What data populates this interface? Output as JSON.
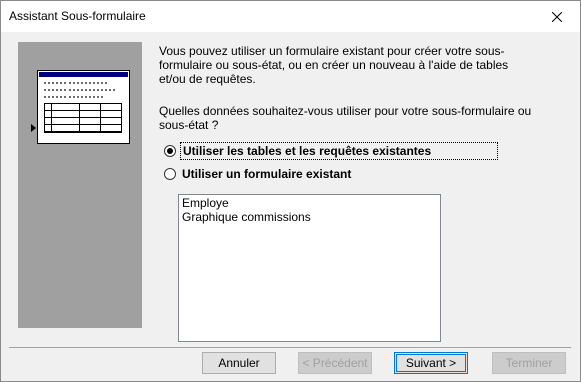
{
  "window": {
    "title": "Assistant Sous-formulaire"
  },
  "description": "Vous pouvez utiliser un formulaire existant pour créer votre sous-formulaire ou sous-état, ou en créer un nouveau à l'aide de tables et/ou de requêtes.",
  "question": "Quelles données souhaitez-vous utiliser pour votre sous-formulaire ou sous-état ?",
  "options": [
    {
      "label": "Utiliser les tables et les requêtes existantes",
      "selected": true
    },
    {
      "label": "Utiliser un formulaire existant",
      "selected": false
    }
  ],
  "forms_list": [
    "Employe",
    "Graphique commissions"
  ],
  "buttons": {
    "cancel": "Annuler",
    "previous": "< Précédent",
    "next": "Suivant >",
    "finish": "Terminer"
  }
}
